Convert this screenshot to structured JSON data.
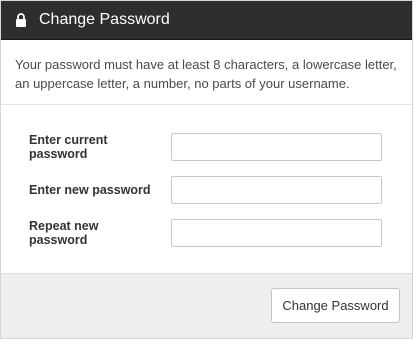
{
  "header": {
    "icon": "lock-icon",
    "title": "Change Password"
  },
  "notice": {
    "text": "Your password must have at least 8 characters, a lowercase letter, an uppercase letter, a number, no parts of your username."
  },
  "form": {
    "fields": [
      {
        "label": "Enter current password",
        "value": "",
        "placeholder": ""
      },
      {
        "label": "Enter new password",
        "value": "",
        "placeholder": ""
      },
      {
        "label": "Repeat new password",
        "value": "",
        "placeholder": ""
      }
    ]
  },
  "footer": {
    "submit_label": "Change Password"
  },
  "colors": {
    "header_bg": "#2e2e2e",
    "footer_bg": "#eeeeee"
  }
}
